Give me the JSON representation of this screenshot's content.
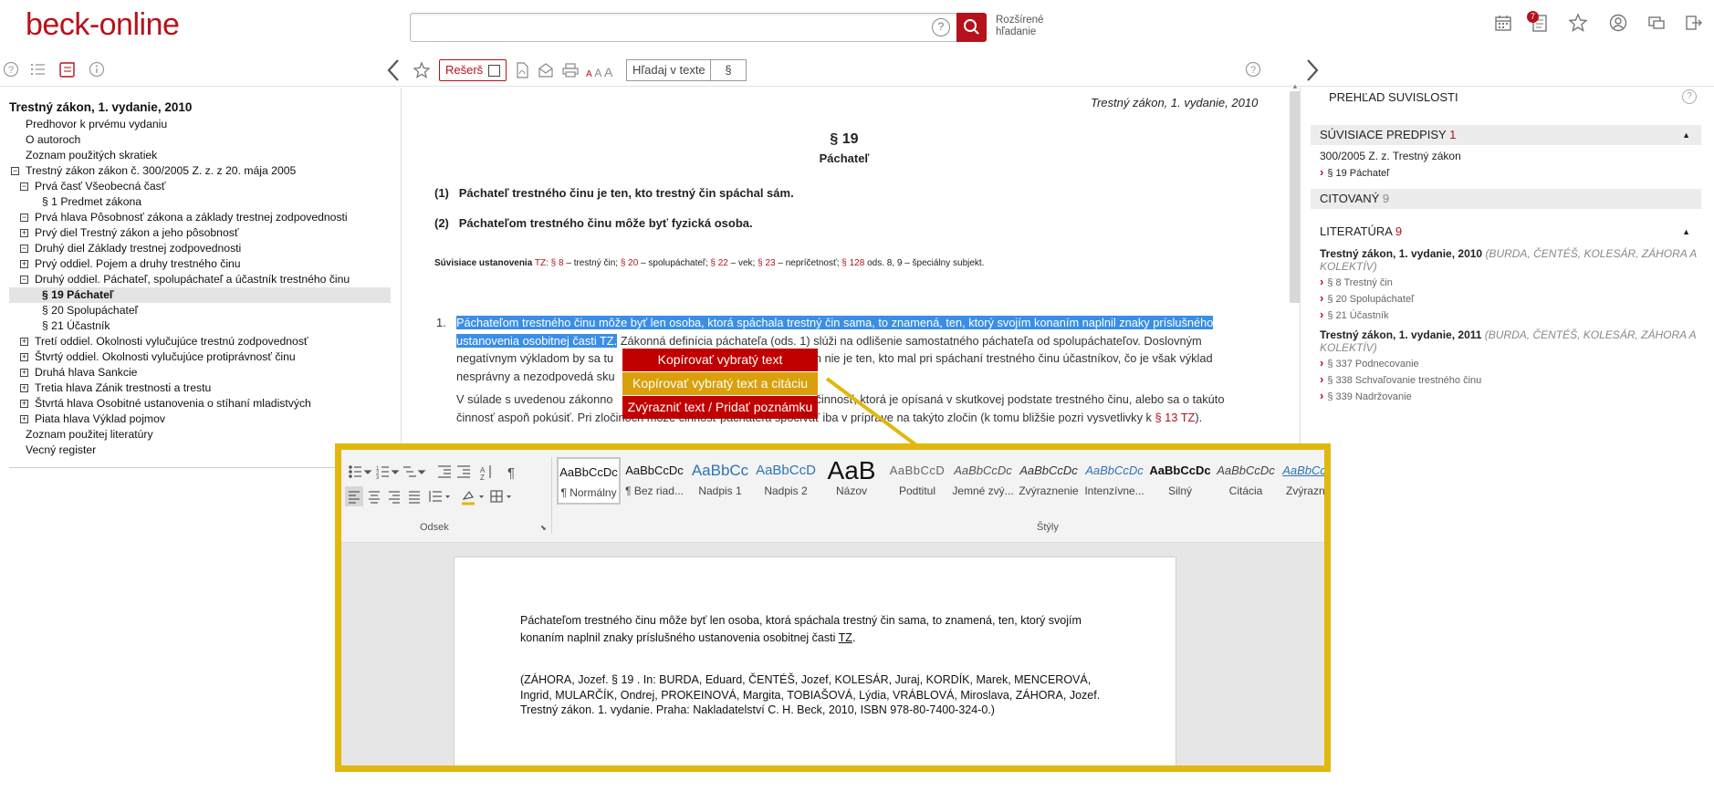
{
  "header": {
    "logo": "beck-online",
    "search_help": "?",
    "advanced_search": "Rozšírené hľadanie",
    "notification_count": "7"
  },
  "toolbar": {
    "resers_label": "Rešerš",
    "font_size_label": "A A A",
    "find_in_text": "Hľadaj v texte",
    "paragraph_symbol": "§"
  },
  "tree": {
    "title": "Trestný zákon, 1. vydanie, 2010",
    "items": [
      {
        "label": "Predhovor k prvému vydaniu",
        "indent": 0,
        "toggle": ""
      },
      {
        "label": "O autoroch",
        "indent": 0,
        "toggle": ""
      },
      {
        "label": "Zoznam použitých skratiek",
        "indent": 0,
        "toggle": ""
      },
      {
        "label": "Trestný zákon zákon č. 300/2005 Z. z. z 20. mája 2005",
        "indent": 0,
        "toggle": "−"
      },
      {
        "label": "Prvá časť Všeobecná časť",
        "indent": 1,
        "toggle": "−"
      },
      {
        "label": "§ 1 Predmet zákona",
        "indent": 2,
        "toggle": ""
      },
      {
        "label": "Prvá hlava Pôsobnosť zákona a základy trestnej zodpovednosti",
        "indent": 1,
        "toggle": "−"
      },
      {
        "label": "Prvý diel Trestný zákon a jeho pôsobnosť",
        "indent": 1,
        "toggle": "+"
      },
      {
        "label": "Druhý diel Základy trestnej zodpovednosti",
        "indent": 1,
        "toggle": "−"
      },
      {
        "label": "Prvý oddiel. Pojem a druhy trestného činu",
        "indent": 1,
        "toggle": "+"
      },
      {
        "label": "Druhý oddiel. Páchateľ, spolupáchateľ a účastník trestného činu",
        "indent": 1,
        "toggle": "−"
      },
      {
        "label": "§ 19 Páchateľ",
        "indent": 2,
        "toggle": "",
        "active": true
      },
      {
        "label": "§ 20 Spolupáchateľ",
        "indent": 2,
        "toggle": ""
      },
      {
        "label": "§ 21 Účastník",
        "indent": 2,
        "toggle": ""
      },
      {
        "label": "Tretí oddiel. Okolnosti vylučujúce trestnú zodpovednosť",
        "indent": 1,
        "toggle": "+"
      },
      {
        "label": "Štvrtý oddiel. Okolnosti vylučujúce protiprávnosť činu",
        "indent": 1,
        "toggle": "+"
      },
      {
        "label": "Druhá hlava Sankcie",
        "indent": 1,
        "toggle": "+"
      },
      {
        "label": "Tretia hlava Zánik trestnosti a trestu",
        "indent": 1,
        "toggle": "+"
      },
      {
        "label": "Štvrtá hlava Osobitné ustanovenia o stíhaní mladistvých",
        "indent": 1,
        "toggle": "+"
      },
      {
        "label": "Piata hlava Výklad pojmov",
        "indent": 1,
        "toggle": "+"
      },
      {
        "label": "Zoznam použitej literatúry",
        "indent": 0,
        "toggle": ""
      },
      {
        "label": "Vecný register",
        "indent": 0,
        "toggle": ""
      }
    ]
  },
  "doc": {
    "header": "Trestný zákon, 1. vydanie, 2010",
    "section_number": "§ 19",
    "section_name": "Páchateľ",
    "para1_num": "(1)",
    "para1": "Páchateľ trestného činu je ten, kto trestný čin spáchal sám.",
    "para2_num": "(2)",
    "para2": "Páchateľom trestného činu môže byť fyzická osoba.",
    "related_label": "Súvisiace ustanovenia",
    "related_tz": "TZ:",
    "related": [
      {
        "ref": "§ 8",
        "desc": " – trestný čin; "
      },
      {
        "ref": "§ 20",
        "desc": " – spolupáchateľ; "
      },
      {
        "ref": "§ 22",
        "desc": " – vek; "
      },
      {
        "ref": "§ 23",
        "desc": " – nepríčetnosť; "
      },
      {
        "ref": "§ 128",
        "desc": " ods. 8, 9 – špeciálny subjekt."
      }
    ],
    "comment_num": "1.",
    "comment_highlight_1": "Páchateľom trestného činu môže byť len osoba, ktorá spáchala trestný čin sama, to znamená, ten, ktorý svojím konaním naplnil znaky príslušného",
    "comment_highlight_2": "ustanovenia osobitnej časti TZ.",
    "comment_rest_1": " Zákonná definícia páchateľa (ods. 1) slúži na odlišenie samostatného páchateľa od spolupáchateľov. Doslovným",
    "comment_line3": "negatívnym výkladom by sa tu",
    "comment_line3_end": "om nie je ten, kto mal pri spáchaní trestného činu účastníkov, čo je však výklad",
    "comment_line4": "nesprávny a nezodpovedá sku",
    "comment2_line1_start": "V súlade s uvedenou zákonno",
    "comment2_line1_end": "činnosť, ktorá je opísaná v skutkovej podstate trestného činu, alebo sa o takúto",
    "comment2_line2": "činnosť aspoň pokúsiť. Pri zločinoch môže činnosť páchateľa spočívať iba v príprave na takýto zločin (k tomu bližšie pozri vysvetlivky k ",
    "comment2_link": "§ 13 TZ",
    "comment2_end": ")."
  },
  "context_menu": {
    "item1": "Kopírovať vybratý text",
    "item2": "Kopírovať vybratý text a citáciu",
    "item3": "Zvýrazniť text / Pridať poznámku",
    "color1": "#c00000",
    "color2": "#d9a00b",
    "color3": "#c00000"
  },
  "right_panel": {
    "title": "PREHĽAD SUVISLOSTI",
    "help": "?",
    "related_regs_label": "SÚVISIACE PREDPISY",
    "related_regs_count": "1",
    "reg_line_bold": "300/2005 Z. z.",
    "reg_line_rest": " Trestný zákon",
    "reg_sub": "§ 19 Páchateľ",
    "cited_label": "CITOVANÝ",
    "cited_count": "9",
    "literature_label": "LITERATÚRA",
    "literature_count": "9",
    "book1_title": "Trestný zákon, 1. vydanie, 2010",
    "book1_authors": "(BURDA, ČENTÉŠ, KOLESÁR, ZÁHORA A KOLEKTÍV)",
    "book1_items": [
      "§ 8 Trestný čin",
      "§ 20 Spolupáchateľ",
      "§ 21 Účastník"
    ],
    "book2_title": "Trestný zákon, 1. vydanie, 2011",
    "book2_authors": "(BURDA, ČENTÉŠ, KOLESÁR, ZÁHORA A KOLEKTÍV)",
    "book2_items": [
      "§ 337 Podnecovanie",
      "§ 338 Schvaľovanie trestného činu",
      "§ 339 Nadržovanie"
    ]
  },
  "word": {
    "group_paragraph": "Odsek",
    "group_styles": "Štýly",
    "styles": [
      {
        "sample": "AaBbCcDc",
        "label": "¶ Normálny"
      },
      {
        "sample": "AaBbCcDc",
        "label": "¶ Bez riad..."
      },
      {
        "sample": "AaBbCc",
        "label": "Nadpis 1"
      },
      {
        "sample": "AaBbCcD",
        "label": "Nadpis 2"
      },
      {
        "sample": "AaB",
        "label": "Názov"
      },
      {
        "sample": "AaBbCcD",
        "label": "Podtitul"
      },
      {
        "sample": "AaBbCcDc",
        "label": "Jemné zvý..."
      },
      {
        "sample": "AaBbCcDc",
        "label": "Zvýraznenie"
      },
      {
        "sample": "AaBbCcDc",
        "label": "Intenzívne..."
      },
      {
        "sample": "AaBbCcDc",
        "label": "Silný"
      },
      {
        "sample": "AaBbCcDc",
        "label": "Citácia"
      },
      {
        "sample": "AaBbCcDc",
        "label": "Zvýraznen"
      }
    ],
    "page_text_1": "Páchateľom trestného činu môže byť len osoba, ktorá spáchala trestný čin sama, to znamená, ten, ktorý svojím konaním naplnil znaky príslušného ustanovenia osobitnej časti ",
    "page_text_1_tz": "TZ",
    "page_text_1_end": ".",
    "page_text_2": "(ZÁHORA, Jozef. § 19 . In: BURDA, Eduard, ČENTÉŠ, Jozef, KOLESÁR, Juraj, KORDÍK, Marek, MENCEROVÁ, Ingrid, MULARČÍK, Ondrej, PROKEINOVÁ, Margita, TOBIAŠOVÁ, Lýdia, VRÁBLOVÁ, Miroslava, ZÁHORA, Jozef. Trestný zákon. 1. vydanie. Praha: Nakladatelství C. H. Beck, 2010, ISBN 978-80-7400-324-0.)"
  }
}
